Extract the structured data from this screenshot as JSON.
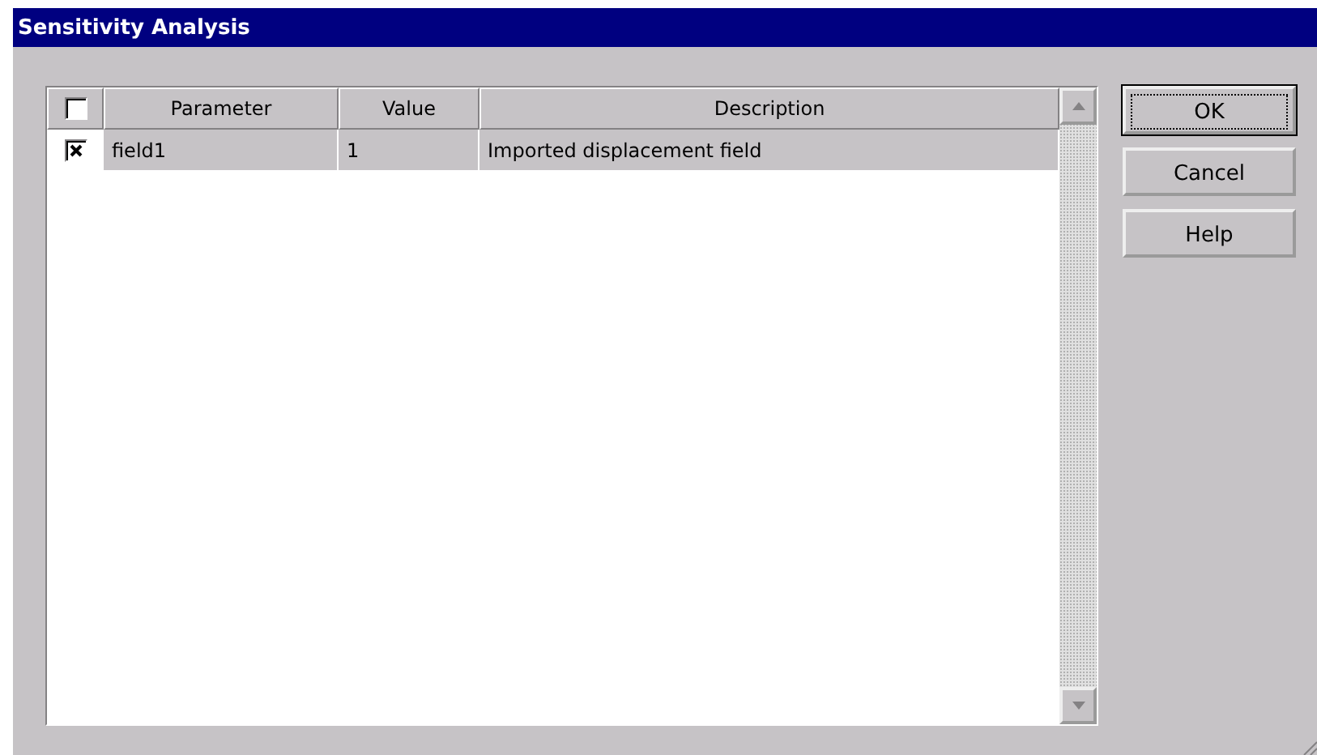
{
  "window": {
    "title": "Sensitivity Analysis"
  },
  "table": {
    "header_checkbox": {
      "checked": false
    },
    "columns": [
      "Parameter",
      "Value",
      "Description"
    ],
    "rows": [
      {
        "checked": true,
        "selected": true,
        "cells": [
          "field1",
          "1",
          "Imported displacement field"
        ]
      }
    ]
  },
  "buttons": [
    {
      "label": "OK",
      "focused": true
    },
    {
      "label": "Cancel",
      "focused": false
    },
    {
      "label": "Help",
      "focused": false
    }
  ]
}
